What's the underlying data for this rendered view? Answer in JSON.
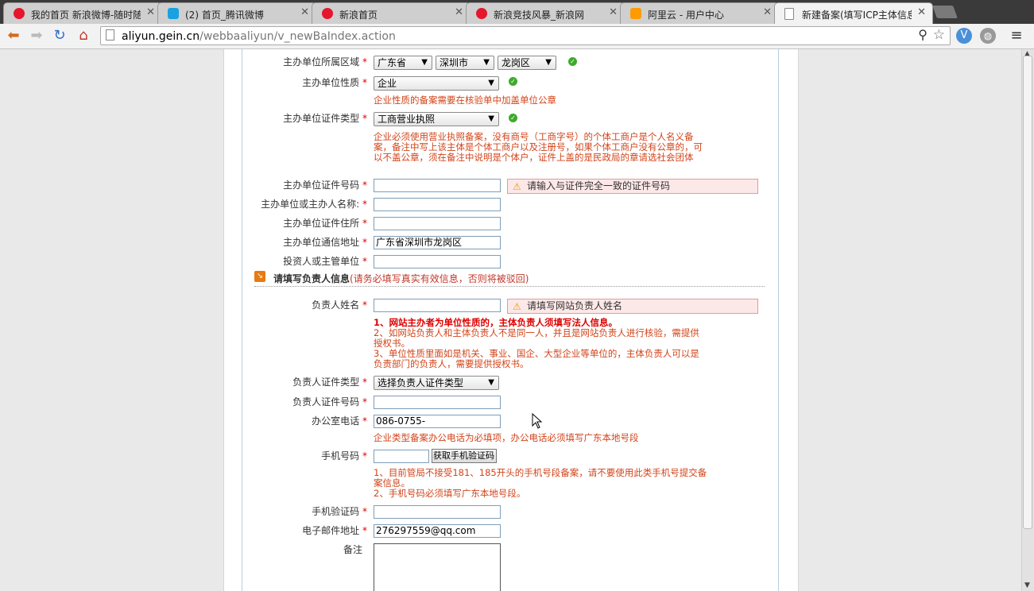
{
  "browser": {
    "tabs": [
      {
        "title": "我的首页 新浪微博-随时随",
        "icon": "weibo-icon",
        "color": "#e6162d",
        "active": false
      },
      {
        "title": "(2) 首页_腾讯微博",
        "icon": "tencent-weibo-icon",
        "color": "#1aa1e1",
        "active": false
      },
      {
        "title": "新浪首页",
        "icon": "sina-icon",
        "color": "#e6162d",
        "active": false
      },
      {
        "title": "新浪竞技风暴_新浪网",
        "icon": "sina-icon",
        "color": "#e6162d",
        "active": false
      },
      {
        "title": "阿里云 - 用户中心",
        "icon": "aliyun-icon",
        "color": "#ff9a00",
        "active": false
      },
      {
        "title": "新建备案(填写ICP主体信息",
        "icon": "page-icon",
        "color": "#ffffff",
        "active": true
      }
    ],
    "url_host": "aliyun.gein.cn",
    "url_path": "/webbaaliyun/v_newBaIndex.action"
  },
  "form": {
    "area_label": "主办单位所属区域",
    "province": "广东省",
    "city": "深圳市",
    "district": "龙岗区",
    "nature_label": "主办单位性质",
    "nature_value": "企业",
    "nature_note": "企业性质的备案需要在核验单中加盖单位公章",
    "cert_type_label": "主办单位证件类型",
    "cert_type_value": "工商营业执照",
    "cert_type_note": "企业必须使用营业执照备案，没有商号（工商字号）的个体工商户是个人名义备案，备注中写上该主体是个体工商户以及注册号，如果个体工商户没有公章的，可以不盖公章，须在备注中说明是个体户，证件上盖的是民政局的章请选社会团体",
    "cert_no_label": "主办单位证件号码",
    "cert_no_warning": "请输入与证件完全一致的证件号码",
    "name_label": "主办单位或主办人名称:",
    "cert_addr_label": "主办单位证件住所",
    "mail_addr_label": "主办单位通信地址",
    "mail_addr_value": "广东省深圳市龙岗区",
    "investor_label": "投资人或主管单位",
    "section_title": "请填写负责人信息",
    "section_subtitle": "(请务必填写真实有效信息，否则将被驳回)",
    "person_name_label": "负责人姓名",
    "person_name_warning": "请填写网站负责人姓名",
    "person_note_1": "1、网站主办者为单位性质的，主体负责人须填写法人信息。",
    "person_note_2": "2、如网站负责人和主体负责人不是同一人，并且是网站负责人进行核验，需提供授权书。",
    "person_note_3": "3、单位性质里面如是机关、事业、国企、大型企业等单位的，主体负责人可以是负责部门的负责人，需要提供授权书。",
    "person_cert_type_label": "负责人证件类型",
    "person_cert_type_value": "选择负责人证件类型",
    "person_cert_no_label": "负责人证件号码",
    "office_phone_label": "办公室电话",
    "office_phone_value": "086-0755-",
    "office_phone_note": "企业类型备案办公电话为必填项，办公电话必须填写广东本地号段",
    "mobile_label": "手机号码",
    "get_code_button": "获取手机验证码",
    "mobile_note_1": "1、目前管局不接受181、185开头的手机号段备案，请不要使用此类手机号提交备案信息。",
    "mobile_note_2": "2、手机号码必须填写广东本地号段。",
    "sms_code_label": "手机验证码",
    "email_label": "电子邮件地址",
    "email_value": "276297559@qq.com",
    "remark_label": "备注",
    "required_mark": "*"
  }
}
